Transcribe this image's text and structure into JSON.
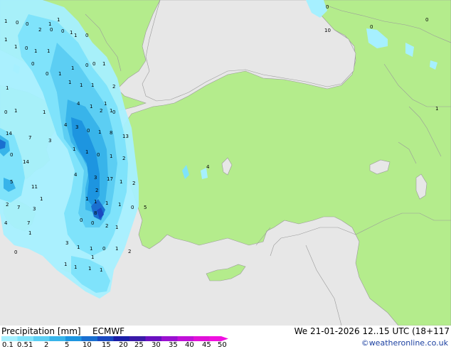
{
  "legend": {
    "title": "Precipitation [mm]",
    "model": "ECMWF",
    "validity": "We 21-01-2026 12..15 UTC (18+117",
    "credit": "©weatheronline.co.uk",
    "ticks": [
      "0.1",
      "0.5",
      "1",
      "2",
      "5",
      "10",
      "15",
      "20",
      "25",
      "30",
      "35",
      "40",
      "45",
      "50"
    ],
    "colors": [
      "#a6f0ff",
      "#7fe3fb",
      "#5ccef3",
      "#38b4ea",
      "#1d95e0",
      "#1a6fd0",
      "#1a48c0",
      "#1a1ea8",
      "#3a1aa8",
      "#6a10c0",
      "#9a10d0",
      "#c010d8",
      "#e010d8",
      "#f010e0"
    ]
  },
  "map": {
    "colors": {
      "sea": "#e7e7e7",
      "land": "#b4ec8c",
      "border": "#909090"
    },
    "values": [
      "1",
      "0",
      "0",
      "1",
      "1",
      "0",
      "1",
      "1",
      "0",
      "1",
      "1",
      "0",
      "0",
      "0",
      "1",
      "1",
      "0",
      "0",
      "1",
      "2",
      "1",
      "1",
      "1",
      "4",
      "1",
      "0",
      "1",
      "2",
      "1",
      "1",
      "0",
      "1",
      "1",
      "14",
      "4",
      "3",
      "0",
      "1",
      "8",
      "13",
      "7",
      "3",
      "1",
      "1",
      "0",
      "1",
      "2",
      "14",
      "0",
      "4",
      "3",
      "17",
      "1",
      "2",
      "11",
      "5",
      "1",
      "2",
      "1",
      "1",
      "1",
      "1",
      "0",
      "5",
      "2",
      "7",
      "3",
      "8",
      "0",
      "0",
      "2",
      "1",
      "1",
      "4",
      "7",
      "3",
      "1",
      "1",
      "0",
      "1",
      "0",
      "2",
      "1",
      "1",
      "1",
      "1",
      "1",
      "0",
      "0",
      "4",
      "10",
      "1",
      "2",
      "0",
      "0",
      "1",
      "1"
    ]
  }
}
